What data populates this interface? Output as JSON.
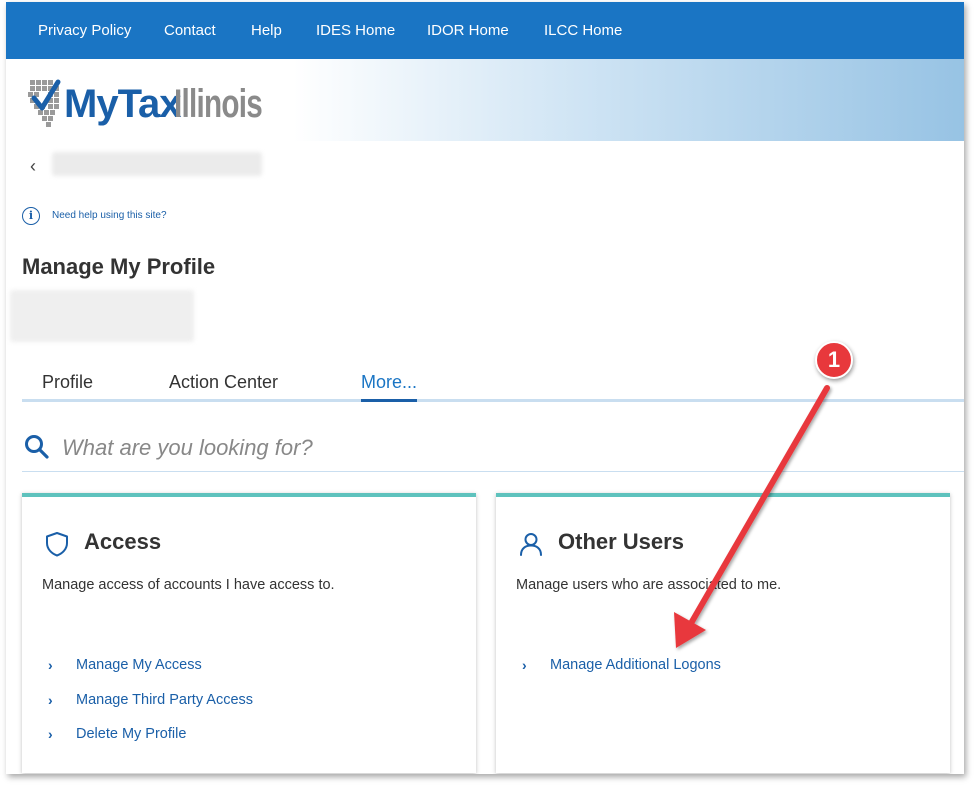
{
  "topnav": {
    "links": [
      "Privacy Policy",
      "Contact",
      "Help",
      "IDES Home",
      "IDOR Home",
      "ILCC Home"
    ]
  },
  "logo": {
    "text_my": "MyTax",
    "text_illinois": "Illinois"
  },
  "help": {
    "text": "Need help using this site?"
  },
  "page": {
    "title": "Manage My Profile"
  },
  "tabs": [
    "Profile",
    "Action Center",
    "More..."
  ],
  "search": {
    "placeholder": "What are you looking for?"
  },
  "cards": [
    {
      "title": "Access",
      "icon": "shield-icon",
      "description": "Manage access of accounts I have access to.",
      "links": [
        "Manage My Access",
        "Manage Third Party Access",
        "Delete My Profile"
      ]
    },
    {
      "title": "Other Users",
      "icon": "user-icon",
      "description": "Manage users who are associated to me.",
      "links": [
        "Manage Additional Logons"
      ]
    }
  ],
  "annotation": {
    "badge": "1"
  },
  "colors": {
    "nav_blue": "#1a75c4",
    "link_blue": "#1a5fa8",
    "card_accent": "#5ec2bd",
    "annotation_red": "#e8383c"
  }
}
